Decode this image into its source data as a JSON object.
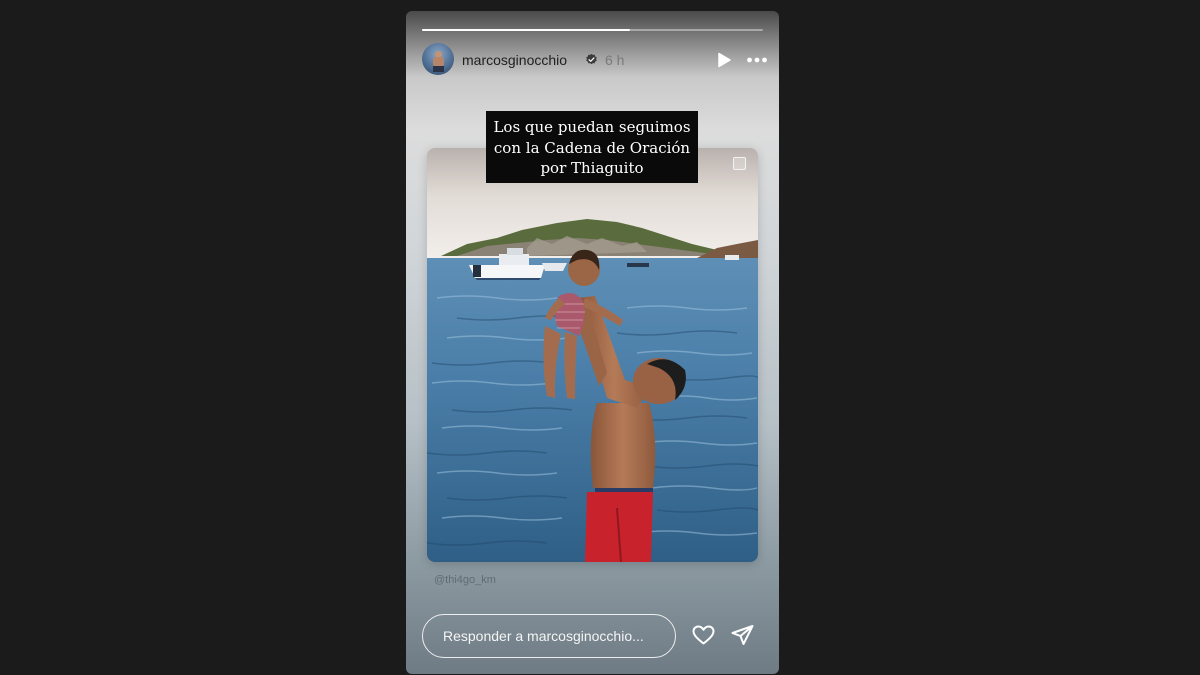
{
  "story": {
    "progress": 0.61,
    "user": {
      "username": "marcosginocchio",
      "verified": true,
      "time": "6 h"
    },
    "controls": {
      "play_icon": "play-icon",
      "more_icon": "more-horizontal-icon"
    },
    "caption": {
      "lines": [
        "Los que puedan seguimos",
        "con la Cadena de Oración",
        "por Thiaguito"
      ]
    },
    "mention": "@thi4go_km",
    "reply": {
      "placeholder": "Responder a marcosginocchio...",
      "value": ""
    },
    "actions": {
      "like_icon": "heart-icon",
      "share_icon": "send-icon"
    }
  },
  "colors": {
    "page_background": "#1b1b1b",
    "caption_background": "#0a0a0a",
    "verified_badge": "#3b3b3b",
    "swim_shorts": "#c8232c"
  }
}
